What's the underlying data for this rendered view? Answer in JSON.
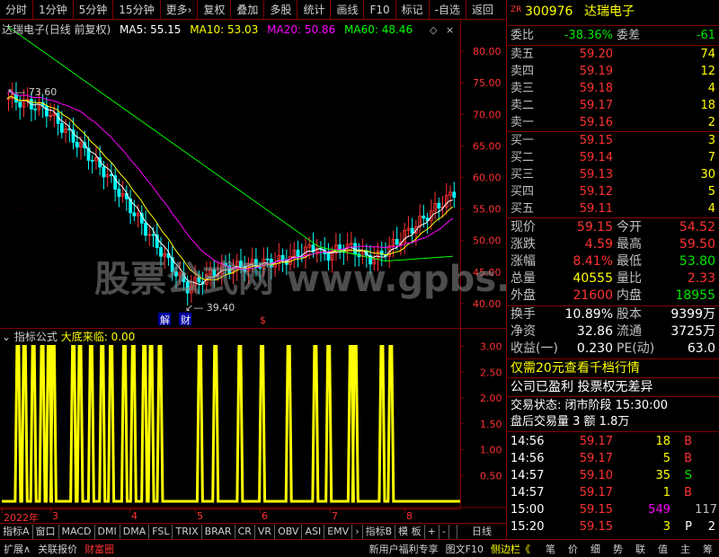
{
  "toolbar": {
    "items": [
      "分时",
      "1分钟",
      "5分钟",
      "15分钟",
      "更多›",
      "复权",
      "叠加",
      "多股",
      "统计",
      "画线",
      "F10",
      "标记",
      "-自选",
      "返回"
    ]
  },
  "chart": {
    "stock_name": "达瑞电子",
    "period": "(日线 前复权)",
    "ma5": "MA5: 55.15",
    "ma10": "MA10: 53.03",
    "ma20": "MA20: 50.86",
    "ma60": "MA60: 48.46",
    "high_label": "73.60",
    "low_label": "39.40",
    "marker_jie": "解",
    "marker_cai": "财",
    "marker_s": "$",
    "watermark": "股票公式网 www.gpbs.cn"
  },
  "indicator": {
    "name": "指标公式",
    "signal": "大底来临: 0.00"
  },
  "colors": {
    "ma5": "#ffffff",
    "ma10": "#ffff00",
    "ma20": "#ff00ff",
    "ma60": "#00ff00",
    "up": "#ff3232",
    "down": "#00ffff",
    "signal": "#ffff00",
    "grid": "#800000"
  },
  "chart_data": [
    {
      "type": "line",
      "yticks": [
        "80.00",
        "75.00",
        "70.00",
        "65.00",
        "60.00",
        "55.00",
        "50.00",
        "45.00",
        "40.00"
      ],
      "ylim": [
        38,
        83
      ],
      "x_labels": [
        "2022年",
        "3",
        "4",
        "5",
        "6",
        "7",
        "8"
      ],
      "series": [
        {
          "name": "MA5",
          "last": 55.15
        },
        {
          "name": "MA10",
          "last": 53.03
        },
        {
          "name": "MA20",
          "last": 50.86
        },
        {
          "name": "MA60",
          "last": 48.46
        }
      ],
      "annotations": [
        "73.60",
        "39.40"
      ]
    },
    {
      "type": "line",
      "yticks": [
        "3.00",
        "2.50",
        "2.00",
        "1.50",
        "1.00",
        "0.50"
      ],
      "ylim": [
        0,
        3.2
      ],
      "series": [
        {
          "name": "大底来临",
          "last": 0.0
        }
      ],
      "spikes_at": [
        0.02,
        0.08,
        0.1,
        0.15,
        0.2,
        0.24,
        0.3,
        0.32,
        0.44,
        0.5,
        0.62,
        0.66,
        0.72,
        0.8,
        0.88
      ]
    }
  ],
  "bottom_tabs": [
    "指标A",
    "窗口",
    "MACD",
    "DMI",
    "DMA",
    "FSL",
    "TRIX",
    "BRAR",
    "CR",
    "VR",
    "OBV",
    "ASI",
    "EMV",
    "›",
    "指标B",
    "模 板",
    "+",
    "-",
    "日线"
  ],
  "footer": [
    "扩展∧",
    "关联报价",
    "财富圈",
    "新用户福利专享",
    "图文F10",
    "侧边栏《",
    "笔",
    "价",
    "细",
    "势",
    "联",
    "值",
    "主",
    "筹"
  ],
  "quote": {
    "code": "300976",
    "name": "达瑞电子",
    "zr": "ZR",
    "weibi_label": "委比",
    "weibi": "-38.36%",
    "weicha_label": "委差",
    "weicha": "-61",
    "sell": [
      {
        "l": "卖五",
        "p": "59.20",
        "v": "74"
      },
      {
        "l": "卖四",
        "p": "59.19",
        "v": "12"
      },
      {
        "l": "卖三",
        "p": "59.18",
        "v": "4"
      },
      {
        "l": "卖二",
        "p": "59.17",
        "v": "18"
      },
      {
        "l": "卖一",
        "p": "59.16",
        "v": "2"
      }
    ],
    "buy": [
      {
        "l": "买一",
        "p": "59.15",
        "v": "3"
      },
      {
        "l": "买二",
        "p": "59.14",
        "v": "7"
      },
      {
        "l": "买三",
        "p": "59.13",
        "v": "30"
      },
      {
        "l": "买四",
        "p": "59.12",
        "v": "5"
      },
      {
        "l": "买五",
        "p": "59.11",
        "v": "4"
      }
    ],
    "stats": [
      {
        "a": "现价",
        "b": "59.15",
        "c": "今开",
        "d": "54.52",
        "bc": "red",
        "dc": "red"
      },
      {
        "a": "涨跌",
        "b": "4.59",
        "c": "最高",
        "d": "59.50",
        "bc": "red",
        "dc": "red"
      },
      {
        "a": "涨幅",
        "b": "8.41%",
        "c": "最低",
        "d": "53.80",
        "bc": "red",
        "dc": "green"
      },
      {
        "a": "总量",
        "b": "40555",
        "c": "量比",
        "d": "2.33",
        "bc": "yellow",
        "dc": "red"
      },
      {
        "a": "外盘",
        "b": "21600",
        "c": "内盘",
        "d": "18955",
        "bc": "red",
        "dc": "green"
      }
    ],
    "stats2": [
      {
        "a": "换手",
        "b": "10.89%",
        "c": "股本",
        "d": "9399万"
      },
      {
        "a": "净资",
        "b": "32.86",
        "c": "流通",
        "d": "3725万"
      },
      {
        "a": "收益(一)",
        "b": "0.230",
        "c": "PE(动)",
        "d": "63.0"
      }
    ],
    "promo": "仅需20元查看千档行情",
    "note": "公司已盈利 投票权无差异",
    "status": "交易状态: 闭市阶段 15:30:00",
    "after": "盘后交易量 3 额 1.8万",
    "ticks": [
      {
        "t": "14:56",
        "p": "59.17",
        "v": "18",
        "s": "B",
        "vc": "yellow",
        "sc": "red"
      },
      {
        "t": "14:56",
        "p": "59.17",
        "v": "5",
        "s": "B",
        "vc": "yellow",
        "sc": "red"
      },
      {
        "t": "14:57",
        "p": "59.10",
        "v": "35",
        "s": "S",
        "vc": "yellow",
        "sc": "green"
      },
      {
        "t": "14:57",
        "p": "59.17",
        "v": "1",
        "s": "B",
        "vc": "yellow",
        "sc": "red"
      },
      {
        "t": "15:00",
        "p": "59.15",
        "v": "549",
        "s": "117",
        "vc": "mag",
        "sc": "gray"
      },
      {
        "t": "15:20",
        "p": "59.15",
        "v": "3",
        "s": "P",
        "x": "2",
        "vc": "yellow",
        "sc": "white"
      }
    ]
  }
}
